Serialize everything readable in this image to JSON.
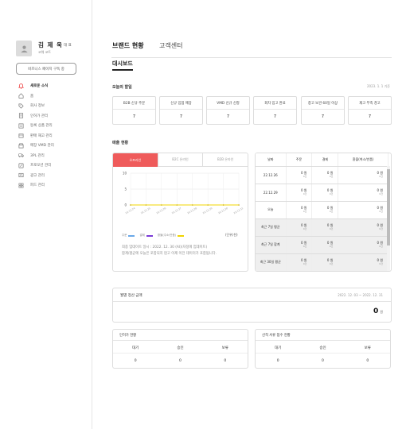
{
  "user": {
    "name": "김 제 욱",
    "role": "대 표",
    "sub": "코웨 코트"
  },
  "sidebar": {
    "business_button": "비즈니스 페이지 구독 중",
    "items": [
      {
        "label": "새로운 소식",
        "icon": "notification-icon"
      },
      {
        "label": "홈",
        "icon": "home-icon"
      },
      {
        "label": "회사 정보",
        "icon": "tag-icon"
      },
      {
        "label": "인허가 관리",
        "icon": "document-icon"
      },
      {
        "label": "등록 상품 관리",
        "icon": "list-icon"
      },
      {
        "label": "판매 재고 관리",
        "icon": "box-icon"
      },
      {
        "label": "매장 VMD 관리",
        "icon": "store-icon"
      },
      {
        "label": "3PL 관리",
        "icon": "truck-icon"
      },
      {
        "label": "프로모션 관리",
        "icon": "promotion-icon"
      },
      {
        "label": "광고 관리",
        "icon": "ad-icon"
      },
      {
        "label": "피드 관리",
        "icon": "feed-icon"
      }
    ]
  },
  "header": {
    "tab_brand": "브랜드 현황",
    "tab_cs": "고객센터",
    "sub_tab": "대시보드"
  },
  "today": {
    "title": "오늘의 할일",
    "date": "2023. 1. 1 기준",
    "stats": [
      {
        "label": "B2B 신규 주문",
        "value": "7"
      },
      {
        "label": "신규 입점 매장",
        "value": "7"
      },
      {
        "label": "VMD 신규 신청",
        "value": "7"
      },
      {
        "label": "회차 입고 완료",
        "value": "7"
      },
      {
        "label": "창고 보관 60일 이상",
        "value": "7"
      },
      {
        "label": "재고 부족 경고",
        "value": "7"
      }
    ]
  },
  "sales": {
    "title": "매출 현황",
    "tabs": [
      "오프라인",
      "B2C 온라인",
      "B2B 온라인"
    ],
    "unit": "(단위:천)",
    "note_line1": "최종 업데이트 일시 : 2022. 12. 30 (AI)(자정에 업데이트)",
    "note_line2": "합계/평균에 오늘은 포함되지 않고 이제 이전 데이터가 포함됩니다.",
    "legend": [
      {
        "label": "주문",
        "color": "#6aa8e8"
      },
      {
        "label": "결제",
        "color": "#7a3ad6"
      },
      {
        "label": "환불(주소/반품)",
        "color": "#f0d400"
      }
    ],
    "table": {
      "headers": [
        "날짜",
        "주문",
        "결제",
        "환불(취소/반품)"
      ],
      "unit_small": "0건",
      "rows": [
        {
          "label": "22.12.26",
          "cells": [
            "0 원",
            "0 원",
            "0 원"
          ],
          "grey": false
        },
        {
          "label": "22.12.29",
          "cells": [
            "0 원",
            "0 원",
            "0 원"
          ],
          "grey": false
        },
        {
          "label": "오늘",
          "cells": [
            "0 원",
            "0 원",
            "0 원"
          ],
          "grey": false
        },
        {
          "label": "최근 7일 평균",
          "cells": [
            "0 원",
            "0 원",
            "0 원"
          ],
          "grey": true
        },
        {
          "label": "최근 7일 합계",
          "cells": [
            "0 원",
            "0 원",
            "0 원"
          ],
          "grey": true
        },
        {
          "label": "최근 30일 평균",
          "cells": [
            "0 원",
            "0 원",
            "0 원"
          ],
          "grey": true
        }
      ]
    }
  },
  "chart_data": {
    "type": "line",
    "categories": [
      "22.12.24",
      "22.12.25",
      "22.12.26",
      "22.12.27",
      "22.12.28",
      "22.12.29",
      "22.12.30",
      "22.12.31"
    ],
    "series": [
      {
        "name": "주문",
        "values": [
          0,
          0,
          0,
          0,
          0,
          0,
          0,
          0
        ],
        "color": "#6aa8e8"
      },
      {
        "name": "결제",
        "values": [
          0,
          0,
          0,
          0,
          0,
          0,
          0,
          0
        ],
        "color": "#7a3ad6"
      },
      {
        "name": "환불(주소/반품)",
        "values": [
          0,
          0,
          0,
          0,
          0,
          0,
          0,
          0
        ],
        "color": "#f0d400"
      }
    ],
    "yticks": [
      0,
      5,
      10
    ],
    "ylim": [
      0,
      10
    ],
    "grid": true
  },
  "settlement": {
    "title": "월별 정산 금액",
    "date": "2022. 12. 03 ~ 2022. 12. 31",
    "amount": "0",
    "unit": "원"
  },
  "license": {
    "title": "인허가 현황",
    "headers": [
      "대기",
      "승인",
      "보류"
    ],
    "values": [
      "0",
      "0",
      "0"
    ]
  },
  "vmd": {
    "title": "선적 서류 접수 현황",
    "headers": [
      "대기",
      "승인",
      "보류"
    ],
    "values": [
      "0",
      "0",
      "0"
    ]
  }
}
